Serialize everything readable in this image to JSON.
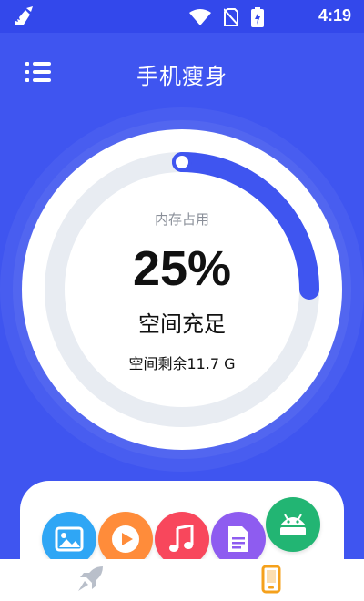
{
  "status_bar": {
    "time": "4:19",
    "icons": [
      "broom-icon",
      "wifi-icon",
      "no-sim-icon",
      "battery-charging-icon"
    ]
  },
  "header": {
    "title": "手机瘦身",
    "menu_icon": "menu-icon"
  },
  "gauge": {
    "label": "内存占用",
    "percent_text": "25%",
    "percent_value": 25,
    "status": "空间充足",
    "remaining": "空间剩余11.7 G"
  },
  "apps": [
    {
      "icon": "image-icon",
      "color": "#2FA6F5"
    },
    {
      "icon": "video-play-icon",
      "color": "#FF8C3A"
    },
    {
      "icon": "music-icon",
      "color": "#F8475C"
    },
    {
      "icon": "document-icon",
      "color": "#8E5CF0"
    },
    {
      "icon": "android-icon",
      "color": "#22B573"
    }
  ],
  "bottom_nav": {
    "items": [
      {
        "icon": "rocket-icon",
        "active": false
      },
      {
        "icon": "phone-icon",
        "active": true
      }
    ]
  },
  "colors": {
    "primary": "#3F55F0",
    "ring_track": "#E8ECF2",
    "ring_progress": "#3F55F0",
    "nav_active": "#F5A11C",
    "nav_inactive": "#B9BFCA"
  }
}
